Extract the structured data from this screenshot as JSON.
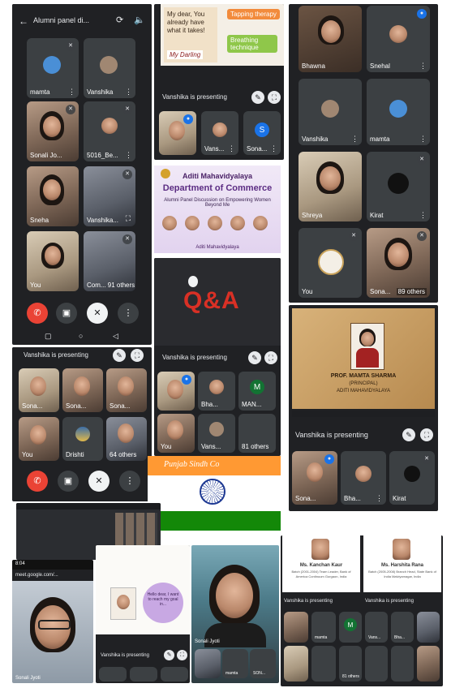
{
  "s1": {
    "title": "Alumni panel di...",
    "tiles": [
      "mamta",
      "Vanshika",
      "Sonali Jo...",
      "5016_Be...",
      "Sneha",
      "Vanshika...",
      "You",
      "Com... 91 others"
    ],
    "nav": [
      "◁",
      "○",
      "▢"
    ]
  },
  "s2": {
    "card1": "My dear, You already have what it takes!",
    "card1_sign": "My Darling",
    "chip1": "Tapping therapy",
    "chip2": "Breathing technique",
    "presenting": "Vanshika is presenting",
    "tiles": [
      "",
      "Vans...",
      "Sona..."
    ]
  },
  "s3": {
    "names": [
      "Bhawna",
      "Snehal",
      "Vanshika",
      "mamta",
      "Shreya",
      "Kirat",
      "You",
      "Sona...",
      "89 others"
    ]
  },
  "s4": {
    "college": "Aditi Mahavidyalaya",
    "dept": "Department of Commerce",
    "tagline": "Alumni Panel Discussion on Empowering Women Beyond Me",
    "footer": "Aditi Mahavidyalaya"
  },
  "s5": {
    "qa": "Q&A",
    "presenting": "Vanshika is presenting",
    "tiles": [
      "",
      "Bha...",
      "MAN...",
      "You",
      "Vans...",
      "81 others"
    ]
  },
  "s6": {
    "slide_title": "PROF. MAMTA SHARMA",
    "slide_sub1": "(PRINCIPAL)",
    "slide_sub2": "ADITI MAHAVIDYALAYA",
    "presenting": "Vanshika is presenting",
    "tiles": [
      "Sona...",
      "Bha...",
      "Kirat"
    ]
  },
  "s7": {
    "presenting": "Vanshika is presenting",
    "tiles": [
      "Sona...",
      "Sona...",
      "Sona...",
      "You",
      "Drishti",
      "64 others"
    ]
  },
  "s8": {
    "banner": "Punjab Sindh Co"
  },
  "s9": {
    "title1": "Ms. Kanchan Kaur",
    "sub1": "Batch (2001-2004) Team Leader, Bank of America Continuum Gurgaon, India",
    "title2": "Ms. Harshita Rana",
    "sub2": "Batch (2005-2008) Branch Head, State Bank of India Malviyamagar, India",
    "presenting": "Vanshika is presenting",
    "tiles": [
      "mamta",
      "Vans...",
      "Bha...",
      "81 others"
    ]
  },
  "s10": {
    "status": "8:04",
    "url": "meet.google.com/...",
    "name": "Sonali Jyoti"
  },
  "s11": {
    "bubble": "Hello dear, I want to reach my goal in...",
    "presenting": "Vanshika is presenting",
    "name": "Sonali Jyoti",
    "tiles": [
      "mamta",
      "SON..."
    ]
  },
  "colors": {
    "meet_dark": "#202124",
    "tile": "#3c4043",
    "end_red": "#ea4335",
    "blue": "#8ab4f8",
    "slide_purple": "#5b2c83",
    "qa_red": "#d93025",
    "qa_green": "#34a853",
    "saffron": "#ff9933",
    "india_green": "#138808"
  }
}
